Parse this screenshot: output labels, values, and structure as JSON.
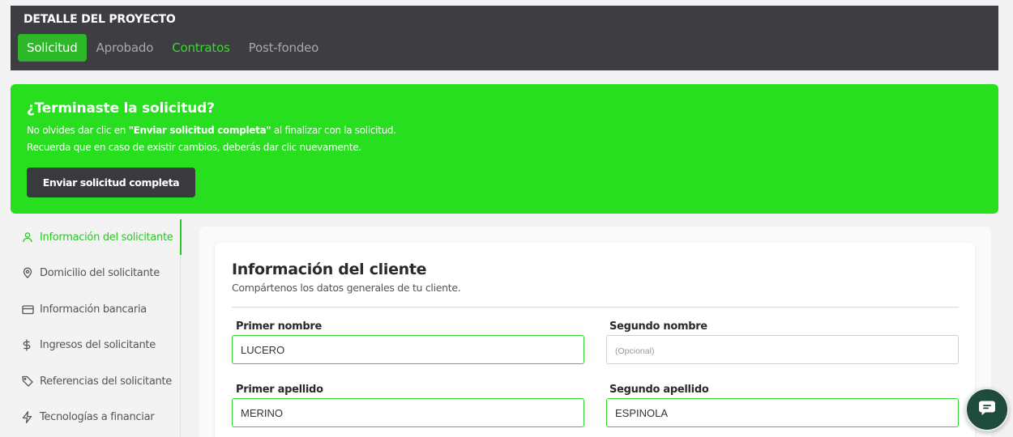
{
  "header": {
    "title": "DETALLE DEL PROYECTO",
    "tabs": [
      {
        "label": "Solicitud",
        "state": "active"
      },
      {
        "label": "Aprobado",
        "state": "inactive"
      },
      {
        "label": "Contratos",
        "state": "highlight"
      },
      {
        "label": "Post-fondeo",
        "state": "inactive"
      }
    ]
  },
  "banner": {
    "title": "¿Terminaste la solicitud?",
    "line1_pre": "No olvides dar clic en ",
    "line1_bold": "\"Enviar solicitud completa\"",
    "line1_post": " al finalizar con la solicitud.",
    "line2": "Recuerda que en caso de existir cambios, deberás dar clic nuevamente.",
    "button_label": "Enviar solicitud completa"
  },
  "sidenav": {
    "items": [
      {
        "label": "Información del solicitante",
        "icon": "user-icon",
        "active": true
      },
      {
        "label": "Domicilio del solicitante",
        "icon": "location-pin-icon",
        "active": false
      },
      {
        "label": "Información bancaria",
        "icon": "credit-card-icon",
        "active": false
      },
      {
        "label": "Ingresos del solicitante",
        "icon": "dollar-icon",
        "active": false
      },
      {
        "label": "Referencias del solicitante",
        "icon": "tag-icon",
        "active": false
      },
      {
        "label": "Tecnologías a financiar",
        "icon": "lightning-icon",
        "active": false
      }
    ]
  },
  "card": {
    "title": "Información del cliente",
    "subtitle": "Compártenos los datos generales de tu cliente.",
    "fields": {
      "primer_nombre": {
        "label": "Primer nombre",
        "value": "LUCERO",
        "placeholder": ""
      },
      "segundo_nombre": {
        "label": "Segundo nombre",
        "value": "",
        "placeholder": "(Opcional)"
      },
      "primer_apellido": {
        "label": "Primer apellido",
        "value": "MERINO",
        "placeholder": ""
      },
      "segundo_apellido": {
        "label": "Segundo apellido",
        "value": "ESPINOLA",
        "placeholder": ""
      }
    }
  },
  "colors": {
    "header_bg": "#3e3e42",
    "banner_bg": "#27de1f",
    "accent_green": "#2cc625",
    "chat_bg": "#1e4b3b"
  },
  "chat": {
    "icon": "chat-icon"
  }
}
